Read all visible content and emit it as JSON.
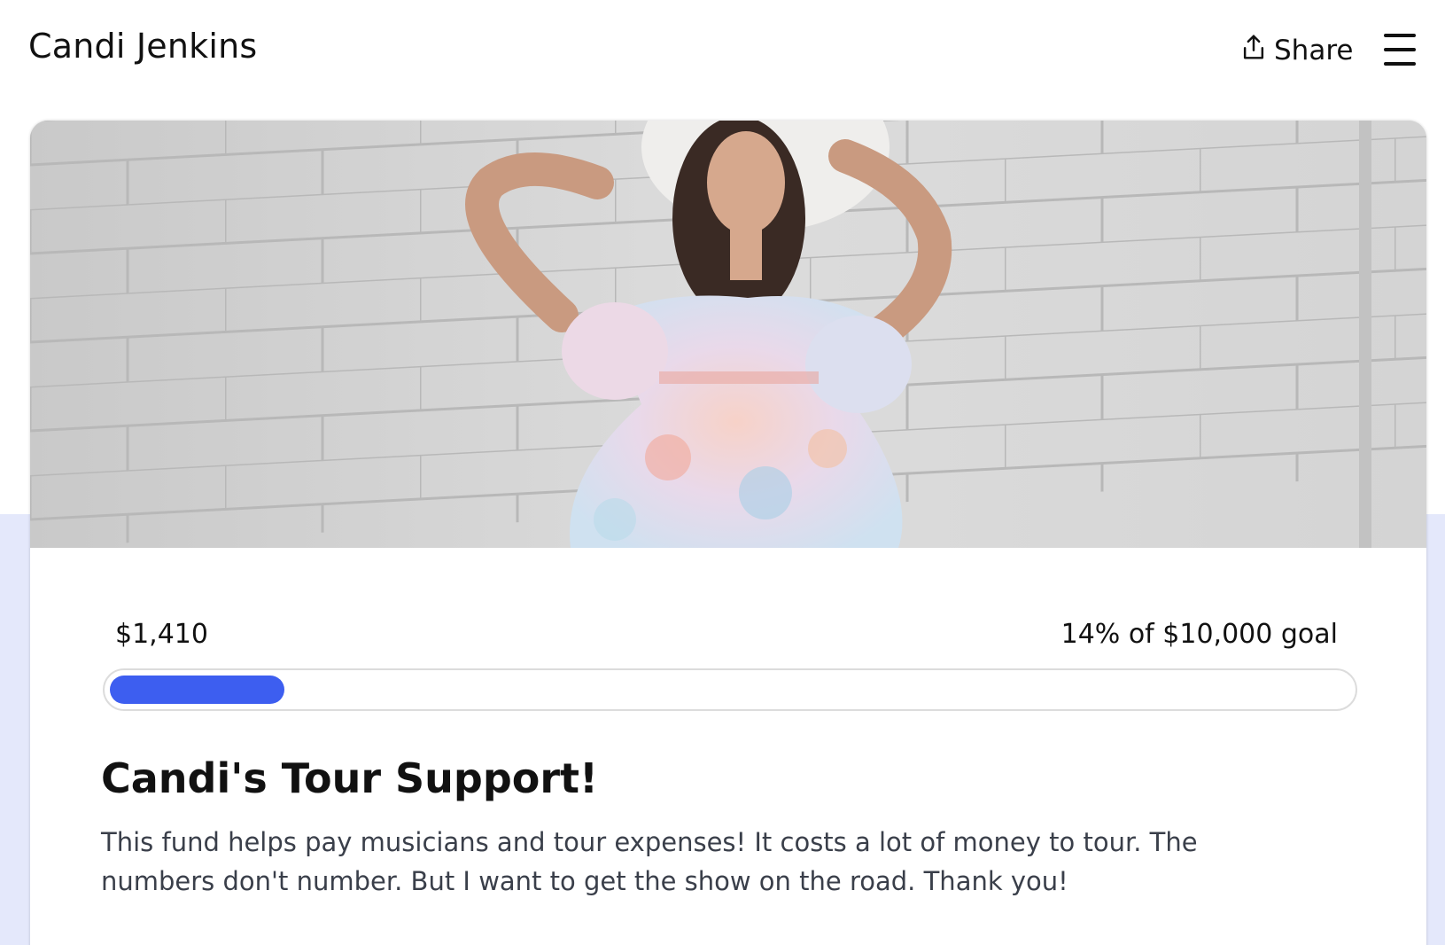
{
  "header": {
    "brand": "Candi Jenkins",
    "share_label": "Share",
    "share_icon": "share-upload-icon",
    "menu_icon": "hamburger-menu-icon"
  },
  "hero": {
    "image_alt": "Woman in a floral dress and wide-brimmed hat posing against a white brick wall"
  },
  "fundraiser": {
    "raised": "$1,410",
    "goal_text": "14% of $10,000 goal",
    "progress_fraction": 0.141,
    "title": "Candi's Tour Support!",
    "description": "This fund helps pay musicians and tour expenses! It costs a lot of money to tour. The numbers don't number. But I want to get the show on the road. Thank you!"
  },
  "colors": {
    "accent": "#3d5ef0",
    "background_tint": "#e4e8fb"
  }
}
